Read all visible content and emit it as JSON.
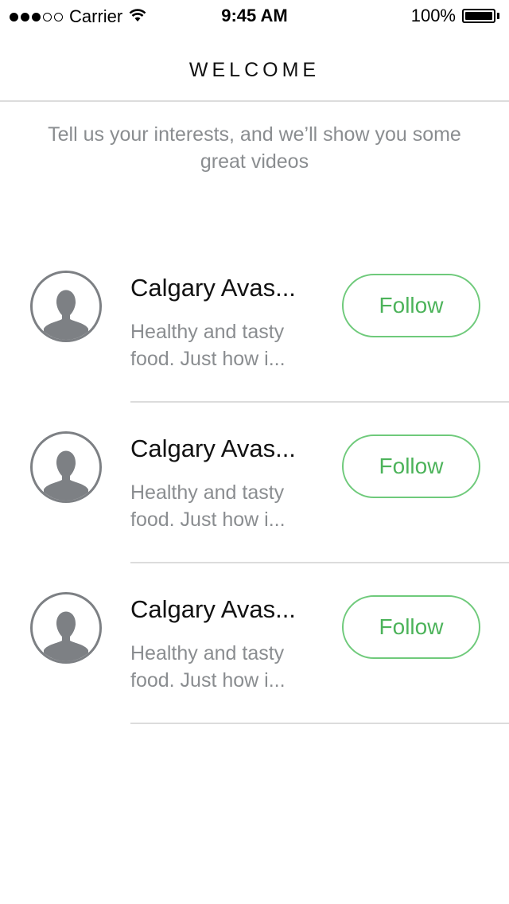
{
  "status_bar": {
    "carrier": "Carrier",
    "time": "9:45 AM",
    "battery_percent": "100%",
    "signal_bars_filled": 3,
    "signal_bars_total": 5
  },
  "nav": {
    "title": "WELCOME"
  },
  "subtitle": "Tell us your interests, and we’ll show you some great videos",
  "items": [
    {
      "name": "Calgary Avas...",
      "description": "Healthy and tasty food. Just how i...",
      "button_label": "Follow",
      "avatar_icon": "person-silhouette-icon"
    },
    {
      "name": "Calgary Avas...",
      "description": "Healthy and tasty food. Just how i...",
      "button_label": "Follow",
      "avatar_icon": "person-silhouette-icon"
    },
    {
      "name": "Calgary Avas...",
      "description": "Healthy and tasty food. Just how i...",
      "button_label": "Follow",
      "avatar_icon": "person-silhouette-icon"
    }
  ],
  "colors": {
    "accent_green": "#4cb35a",
    "button_border": "#6fca7b",
    "secondary_text": "#8a8d90",
    "divider": "#dcdcdc"
  }
}
